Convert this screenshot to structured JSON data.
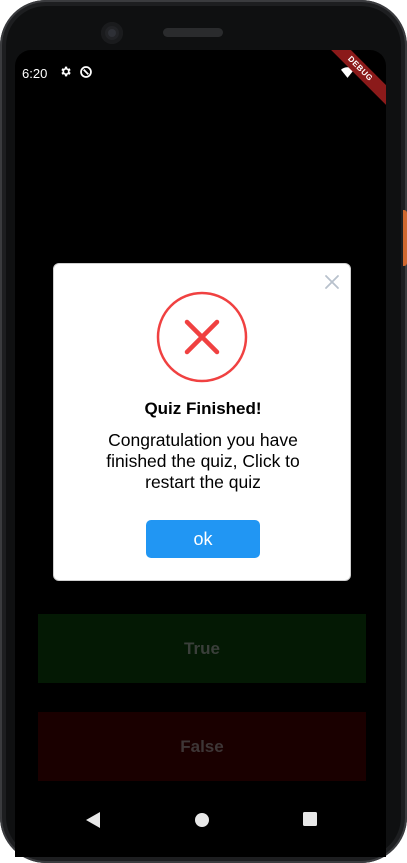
{
  "status_bar": {
    "time": "6:20",
    "debug_label": "DEBUG",
    "icons": [
      "settings-icon",
      "sync-icon",
      "wifi-icon",
      "battery-icon"
    ]
  },
  "quiz": {
    "true_label": "True",
    "false_label": "False",
    "true_color": "#041904",
    "false_color": "#1a0000"
  },
  "dialog": {
    "icon": "error-x-icon",
    "title": "Quiz Finished!",
    "message": "Congratulation you have finished the quiz, Click to restart the quiz",
    "ok_label": "ok",
    "ok_color": "#2196f3",
    "error_color": "#f04141"
  },
  "nav_bar": {
    "icons": [
      "back-icon",
      "home-icon",
      "recents-icon"
    ]
  }
}
